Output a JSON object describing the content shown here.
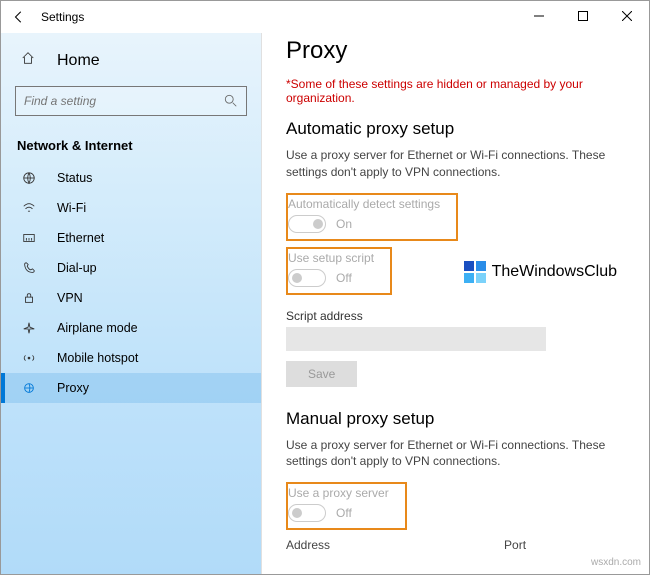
{
  "window": {
    "title": "Settings"
  },
  "search": {
    "placeholder": "Find a setting"
  },
  "nav": {
    "home": "Home",
    "category": "Network & Internet",
    "items": [
      {
        "label": "Status"
      },
      {
        "label": "Wi-Fi"
      },
      {
        "label": "Ethernet"
      },
      {
        "label": "Dial-up"
      },
      {
        "label": "VPN"
      },
      {
        "label": "Airplane mode"
      },
      {
        "label": "Mobile hotspot"
      },
      {
        "label": "Proxy"
      }
    ]
  },
  "page": {
    "title": "Proxy",
    "warning": "*Some of these settings are hidden or managed by your organization.",
    "auto": {
      "title": "Automatic proxy setup",
      "desc": "Use a proxy server for Ethernet or Wi-Fi connections. These settings don't apply to VPN connections.",
      "detect_label": "Automatically detect settings",
      "detect_state": "On",
      "script_label": "Use setup script",
      "script_state": "Off",
      "script_addr_label": "Script address",
      "save": "Save"
    },
    "manual": {
      "title": "Manual proxy setup",
      "desc": "Use a proxy server for Ethernet or Wi-Fi connections. These settings don't apply to VPN connections.",
      "use_label": "Use a proxy server",
      "use_state": "Off",
      "address": "Address",
      "port": "Port"
    }
  },
  "overlay": {
    "brand": "TheWindowsClub"
  },
  "credit": "wsxdn.com"
}
